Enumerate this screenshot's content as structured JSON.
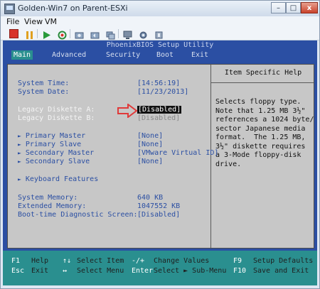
{
  "window": {
    "title": "Golden-Win7 on Parent-ESXi",
    "minimize": "–",
    "maximize": "□",
    "close": "x"
  },
  "menu": [
    "File",
    "View",
    "VM"
  ],
  "toolbar": [
    "stop-icon",
    "pause-icon",
    "play-icon",
    "reset-icon",
    "snapshot-icon",
    "revert-snapshot-icon",
    "manage-snapshots-icon",
    "console-icon",
    "settings-icon",
    "power-icon"
  ],
  "bios": {
    "title": "PhoenixBIOS Setup Utility",
    "tabs": [
      "Main",
      "Advanced",
      "Security",
      "Boot",
      "Exit"
    ],
    "active_tab": "Main",
    "settings": {
      "system_time_label": "System Time:",
      "system_time_value": "[14:56:19]",
      "system_date_label": "System Date:",
      "system_date_value": "[11/23/2013]",
      "legacy_a_label": "Legacy Diskette A:",
      "legacy_a_value": "[Disabled]",
      "legacy_b_label": "Legacy Diskette B:",
      "legacy_b_value": "[Disabled]",
      "primary_master_label": "Primary Master",
      "primary_master_value": "[None]",
      "primary_slave_label": "Primary Slave",
      "primary_slave_value": "[None]",
      "secondary_master_label": "Secondary Master",
      "secondary_master_value": "[VMware Virtual ID]",
      "secondary_slave_label": "Secondary Slave",
      "secondary_slave_value": "[None]",
      "keyboard_features_label": "Keyboard Features",
      "system_memory_label": "System Memory:",
      "system_memory_value": "640 KB",
      "extended_memory_label": "Extended Memory:",
      "extended_memory_value": "1047552 KB",
      "boot_diag_label": "Boot-time Diagnostic Screen:",
      "boot_diag_value": "[Disabled]"
    },
    "help": {
      "title": "Item Specific Help",
      "text": "Selects floppy type.\nNote that 1.25 MB 3½\"\nreferences a 1024 byte/\nsector Japanese media\nformat.  The 1.25 MB,\n3½\" diskette requires\na 3-Mode floppy-disk\ndrive."
    },
    "legend": {
      "f1": "F1",
      "help": "Help",
      "updown": "↑↓",
      "select_item": "Select Item",
      "minusplus": "-/+",
      "change_values": "Change Values",
      "f9": "F9",
      "setup_defaults": "Setup Defaults",
      "esc": "Esc",
      "exit": "Exit",
      "leftright": "↔",
      "select_menu": "Select Menu",
      "enter": "Enter",
      "select_submenu": "Select ► Sub-Menu",
      "f10": "F10",
      "save_exit": "Save and Exit"
    }
  },
  "colors": {
    "bios_blue": "#2b4fa3",
    "bios_teal": "#2a8f8f",
    "panel_grey": "#c7c7c7",
    "arrow_red": "#e03a3a"
  }
}
